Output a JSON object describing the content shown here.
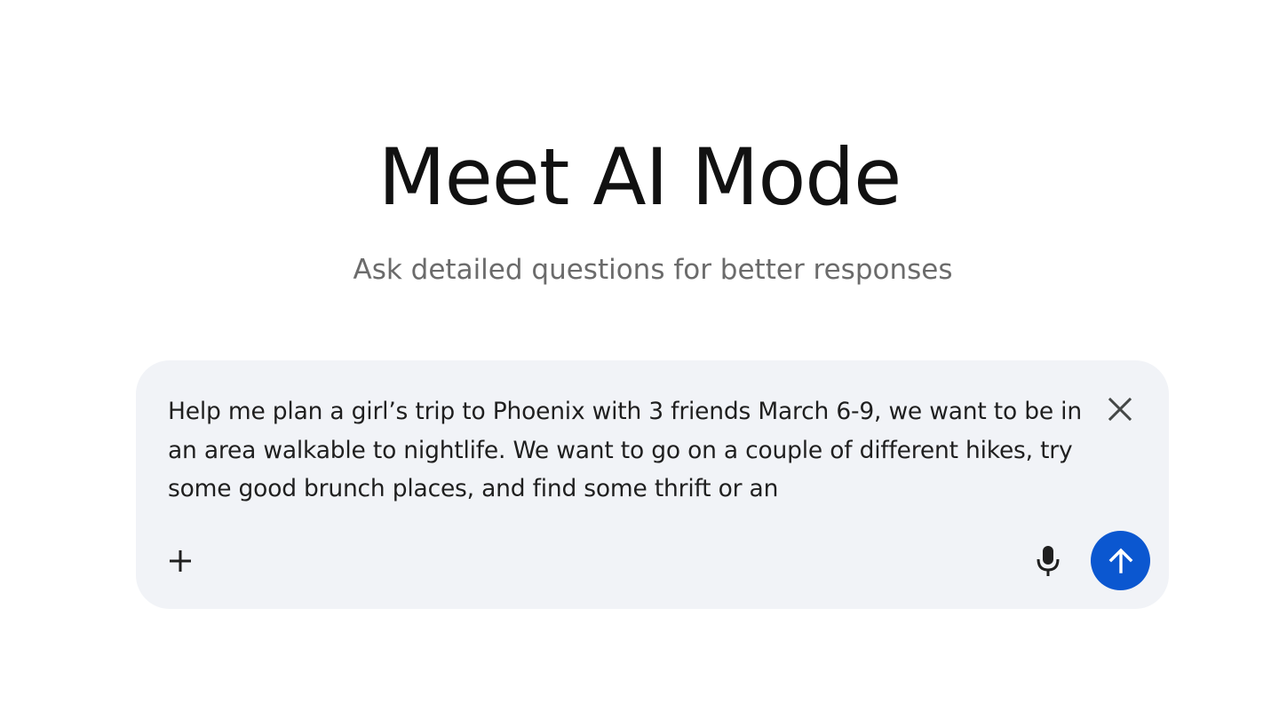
{
  "hero": {
    "title": "Meet AI Mode",
    "subtitle": "Ask detailed questions for better responses"
  },
  "prompt": {
    "text": "Help me plan a girl’s trip to Phoenix with 3 friends March 6-9, we want to be in an area walkable to nightlife. We want to go on a couple of different hikes, try some good brunch places, and find some thrift or an"
  },
  "icons": {
    "close": "close-icon",
    "add": "plus-icon",
    "mic": "microphone-icon",
    "send": "arrow-up-icon"
  },
  "colors": {
    "accent": "#0b57d0",
    "input_background": "#f1f3f7",
    "title_text": "#111111",
    "subtitle_text": "#6b6b6b"
  }
}
